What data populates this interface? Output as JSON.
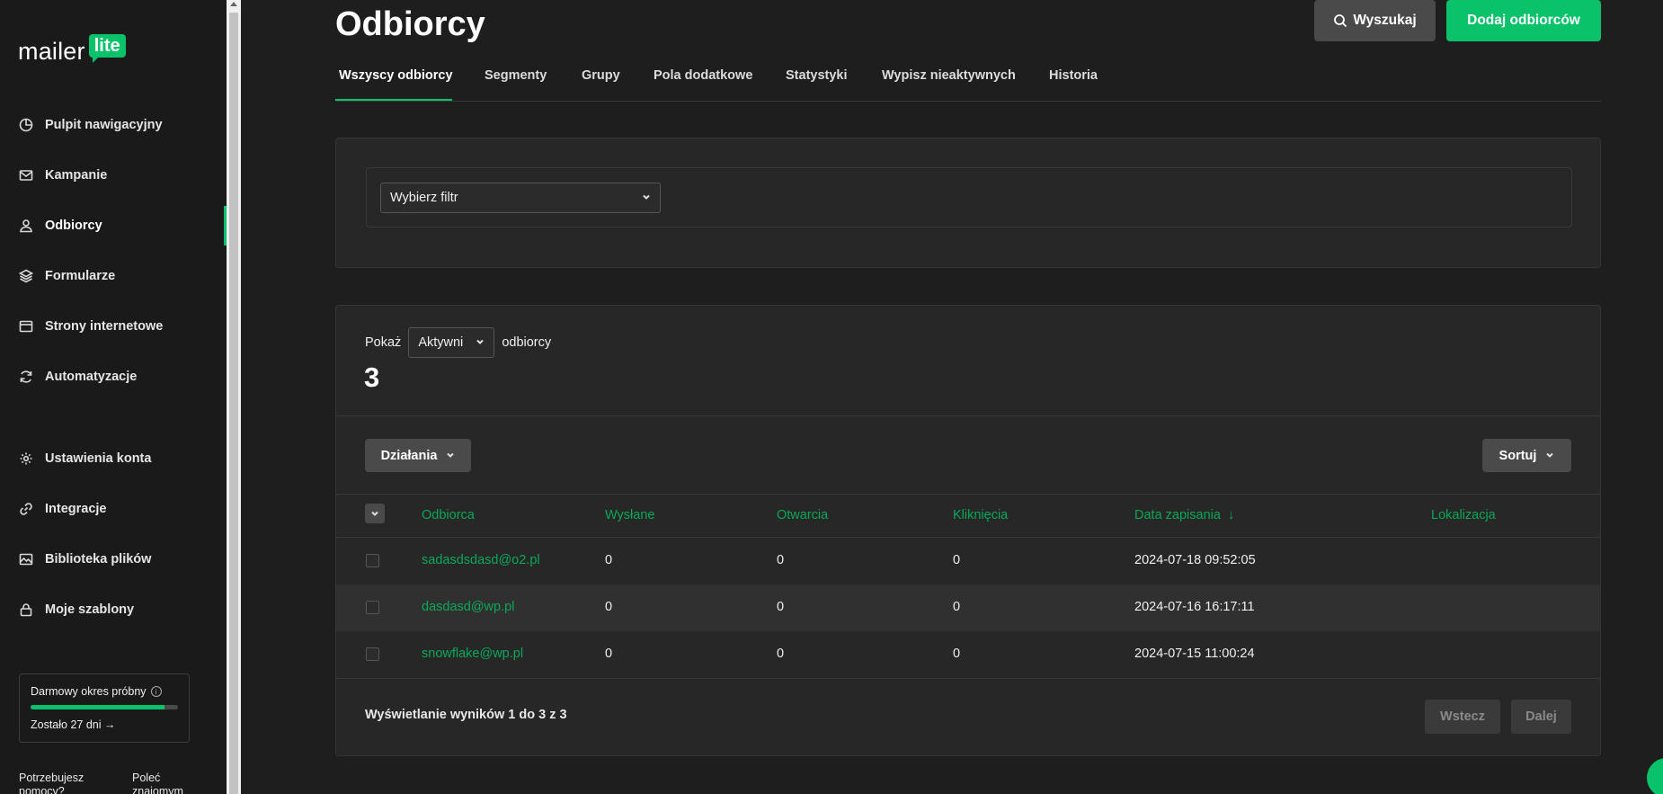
{
  "sidebar": {
    "logo_word": "mailer",
    "logo_badge": "lite",
    "items": [
      {
        "label": "Pulpit nawigacyjny",
        "icon": "dashboard-icon"
      },
      {
        "label": "Kampanie",
        "icon": "mail-icon"
      },
      {
        "label": "Odbiorcy",
        "icon": "user-icon",
        "active": true
      },
      {
        "label": "Formularze",
        "icon": "layers-icon"
      },
      {
        "label": "Strony internetowe",
        "icon": "browser-icon"
      },
      {
        "label": "Automatyzacje",
        "icon": "refresh-icon"
      },
      {
        "label": "Ustawienia konta",
        "icon": "gear-icon"
      },
      {
        "label": "Integracje",
        "icon": "link-icon"
      },
      {
        "label": "Biblioteka plików",
        "icon": "image-icon"
      },
      {
        "label": "Moje szablony",
        "icon": "lock-icon"
      }
    ],
    "trial": {
      "title": "Darmowy okres próbny",
      "remaining": "Zostało 27 dni →",
      "progress": 0.91
    },
    "help": "Potrzebujesz pomocy?",
    "refer": "Poleć znajomym"
  },
  "header": {
    "title": "Odbiorcy",
    "search_label": "Wyszukaj",
    "add_label": "Dodaj odbiorców"
  },
  "tabs": [
    "Wszyscy odbiorcy",
    "Segmenty",
    "Grupy",
    "Pola dodatkowe",
    "Statystyki",
    "Wypisz nieaktywnych",
    "Historia"
  ],
  "filter": {
    "placeholder": "Wybierz filtr"
  },
  "list": {
    "show_label": "Pokaż",
    "status_value": "Aktywni",
    "suffix": "odbiorcy",
    "count": "3",
    "actions_label": "Działania",
    "sort_label": "Sortuj",
    "columns": [
      "Odbiorca",
      "Wysłane",
      "Otwarcia",
      "Kliknięcia",
      "Data zapisania",
      "Lokalizacja"
    ],
    "rows": [
      {
        "email": "sadasdsdasd@o2.pl",
        "sent": "0",
        "opens": "0",
        "clicks": "0",
        "date": "2024-07-18 09:52:05",
        "location": ""
      },
      {
        "email": "dasdasd@wp.pl",
        "sent": "0",
        "opens": "0",
        "clicks": "0",
        "date": "2024-07-16 16:17:11",
        "location": ""
      },
      {
        "email": "snowflake@wp.pl",
        "sent": "0",
        "opens": "0",
        "clicks": "0",
        "date": "2024-07-15 11:00:24",
        "location": ""
      }
    ],
    "pagination_text": "Wyświetlanie wyników 1 do 3 z 3",
    "prev_label": "Wstecz",
    "next_label": "Dalej"
  },
  "colors": {
    "accent": "#09c269",
    "background": "#1e1e1e",
    "card": "#272727"
  }
}
